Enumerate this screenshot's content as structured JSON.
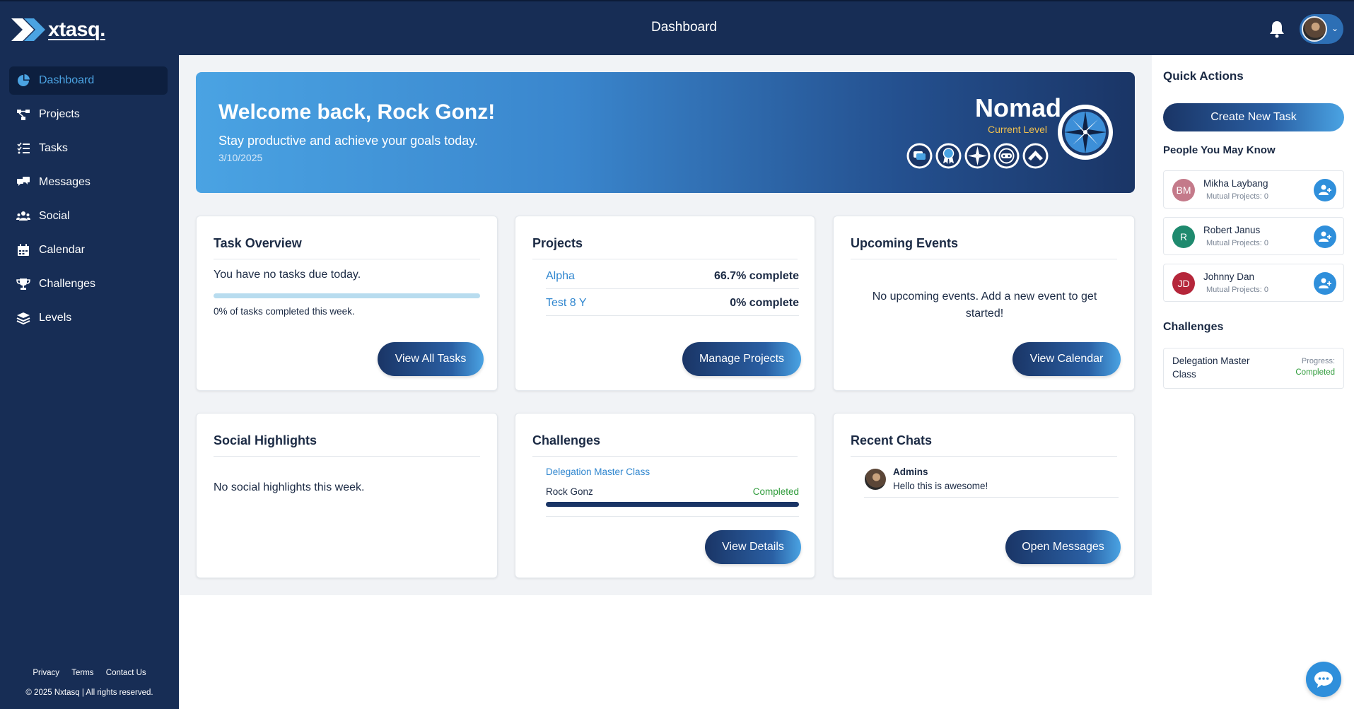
{
  "app": {
    "logo_text": "xtasq.",
    "page_title": "Dashboard"
  },
  "sidebar": {
    "items": [
      {
        "label": "Dashboard",
        "icon": "pie-chart-icon",
        "active": true
      },
      {
        "label": "Projects",
        "icon": "project-diagram-icon"
      },
      {
        "label": "Tasks",
        "icon": "tasks-list-icon"
      },
      {
        "label": "Messages",
        "icon": "messages-icon"
      },
      {
        "label": "Social",
        "icon": "users-icon"
      },
      {
        "label": "Calendar",
        "icon": "calendar-icon"
      },
      {
        "label": "Challenges",
        "icon": "trophy-icon"
      },
      {
        "label": "Levels",
        "icon": "layers-icon"
      }
    ],
    "footer_links": [
      "Privacy",
      "Terms",
      "Contact Us"
    ],
    "copyright": "© 2025 Nxtasq | All rights reserved."
  },
  "hero": {
    "title": "Welcome back, Rock Gonz!",
    "subtitle": "Stay productive and achieve your goals today.",
    "date": "3/10/2025",
    "level_name": "Nomad",
    "level_label": "Current Level"
  },
  "task_overview": {
    "title": "Task Overview",
    "message": "You have no tasks due today.",
    "progress_text": "0% of tasks completed this week.",
    "progress_fraction": 0,
    "button": "View All Tasks"
  },
  "projects": {
    "title": "Projects",
    "rows": [
      {
        "name": "Alpha",
        "status": "66.7% complete"
      },
      {
        "name": "Test 8 Y",
        "status": "0% complete"
      }
    ],
    "button": "Manage Projects"
  },
  "events": {
    "title": "Upcoming Events",
    "message": "No upcoming events. Add a new event to get started!",
    "button": "View Calendar"
  },
  "social": {
    "title": "Social Highlights",
    "message": "No social highlights this week."
  },
  "challenges_card": {
    "title": "Challenges",
    "challenge_name": "Delegation Master Class",
    "user": "Rock Gonz",
    "status": "Completed",
    "progress_fraction": 1,
    "button": "View Details"
  },
  "chats": {
    "title": "Recent Chats",
    "sender": "Admins",
    "message": "Hello this is awesome!",
    "button": "Open Messages"
  },
  "right_panel": {
    "quick_actions_title": "Quick Actions",
    "create_button": "Create New Task",
    "people_title": "People You May Know",
    "people": [
      {
        "initials": "BM",
        "name": "Mikha Laybang",
        "mutual": "Mutual Projects: 0",
        "color": "#c47a8a"
      },
      {
        "initials": "R",
        "name": "Robert Janus",
        "mutual": "Mutual Projects: 0",
        "color": "#1f8a6e"
      },
      {
        "initials": "JD",
        "name": "Johnny Dan",
        "mutual": "Mutual Projects: 0",
        "color": "#b5263a"
      }
    ],
    "challenges_title": "Challenges",
    "challenge": {
      "name": "Delegation Master Class",
      "progress_label": "Progress:",
      "status": "Completed"
    }
  },
  "colors": {
    "navy": "#172d55",
    "accent": "#2f86cf",
    "success": "#2e9b3a",
    "gold": "#f2c14e"
  }
}
